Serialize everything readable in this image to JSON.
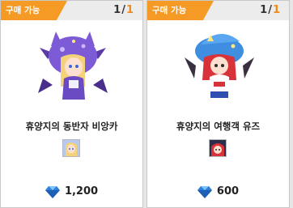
{
  "cards": [
    {
      "tag": "구매 가능",
      "count_current": "1",
      "count_sep": "/",
      "count_max": "1",
      "name": "휴양지의 동반자 비앙카",
      "price": "1,200"
    },
    {
      "tag": "구매 가능",
      "count_current": "1",
      "count_sep": "/",
      "count_max": "1",
      "name": "휴양지의 여행객 유즈",
      "price": "600"
    }
  ],
  "colors": {
    "tag": "#f49a25",
    "count_max": "#f08a1c",
    "gem": "#2d7fd8"
  },
  "icons": {
    "currency": "blue-gem-icon"
  }
}
